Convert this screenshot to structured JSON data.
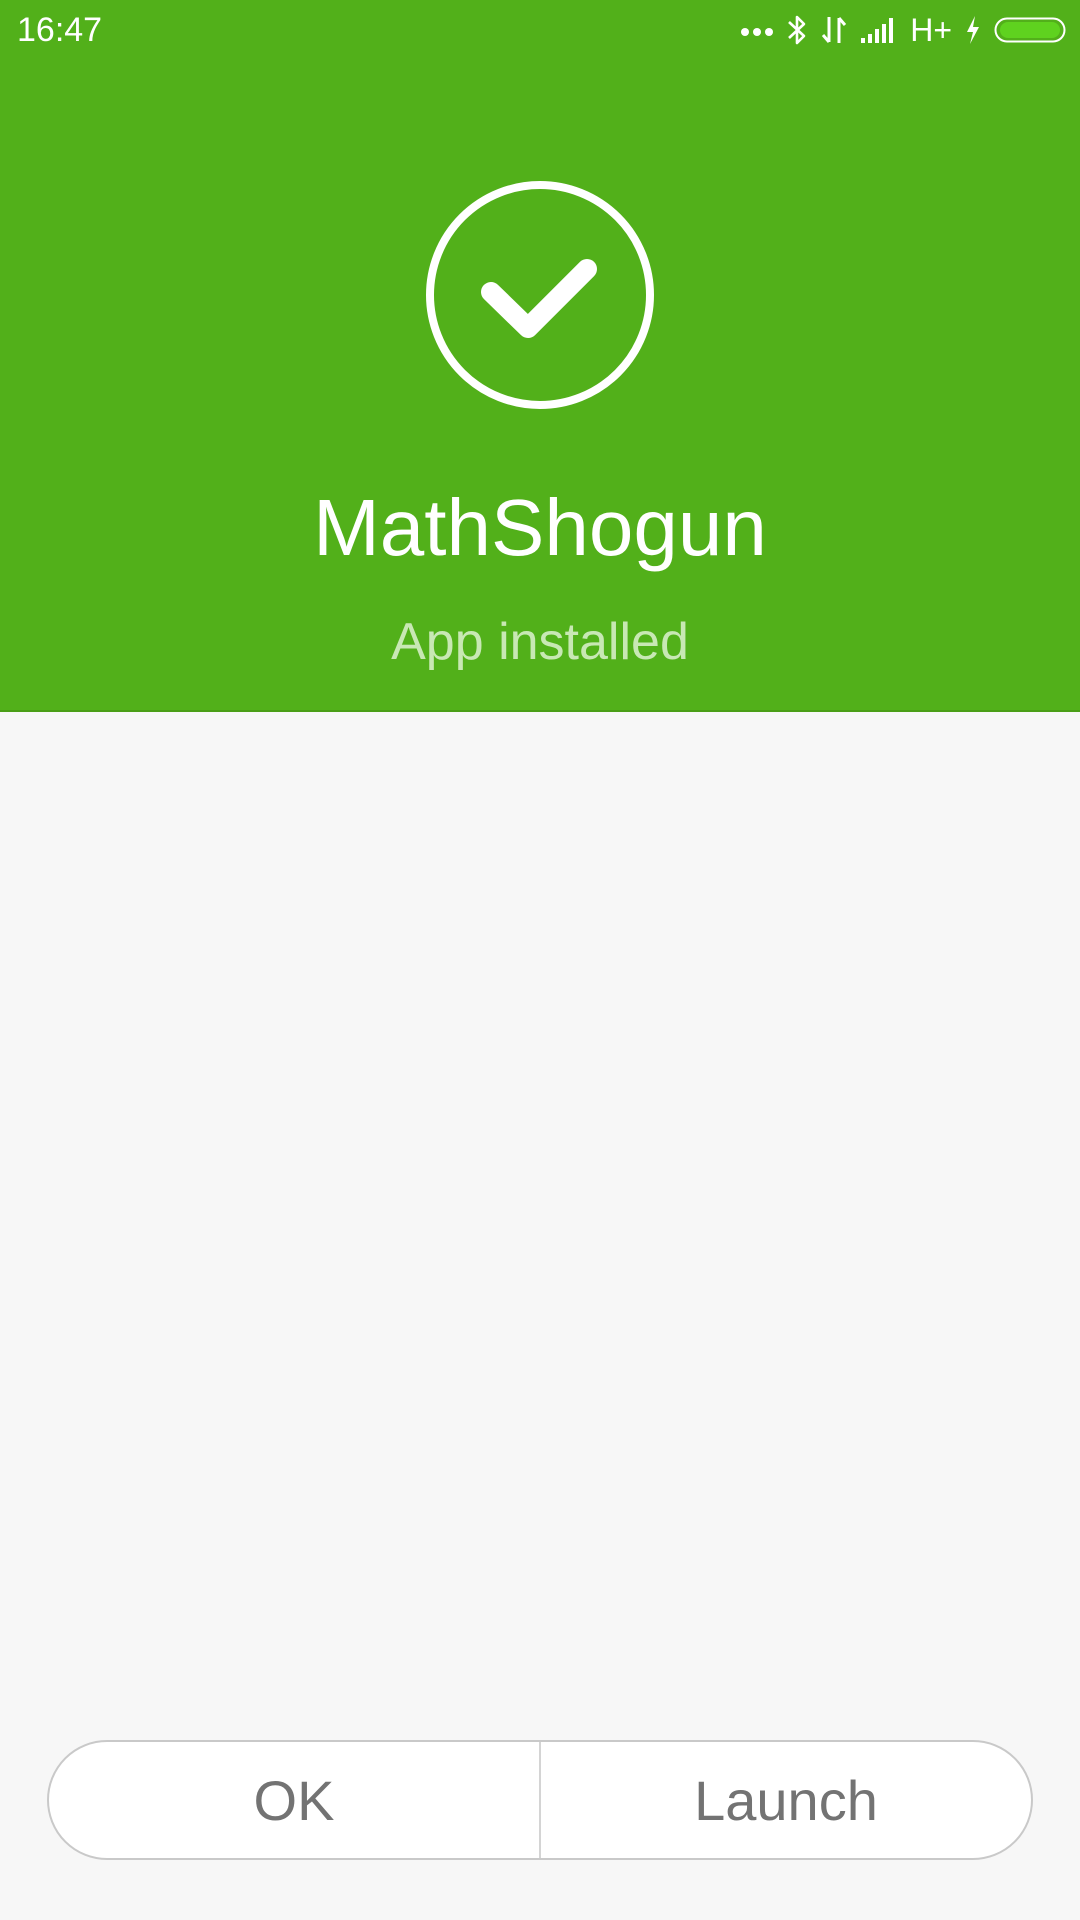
{
  "status_bar": {
    "time": "16:47",
    "network": "H+",
    "icons": [
      "more-dots-icon",
      "bluetooth-icon",
      "data-transfer-icon",
      "signal-icon",
      "charging-icon",
      "battery-icon"
    ]
  },
  "header": {
    "app_name": "MathShogun",
    "status": "App installed",
    "icon": "check-circle-icon"
  },
  "actions": {
    "ok_label": "OK",
    "launch_label": "Launch"
  },
  "colors": {
    "header_bg": "#52b01a",
    "page_bg": "#f7f7f7",
    "button_text": "#737373"
  }
}
